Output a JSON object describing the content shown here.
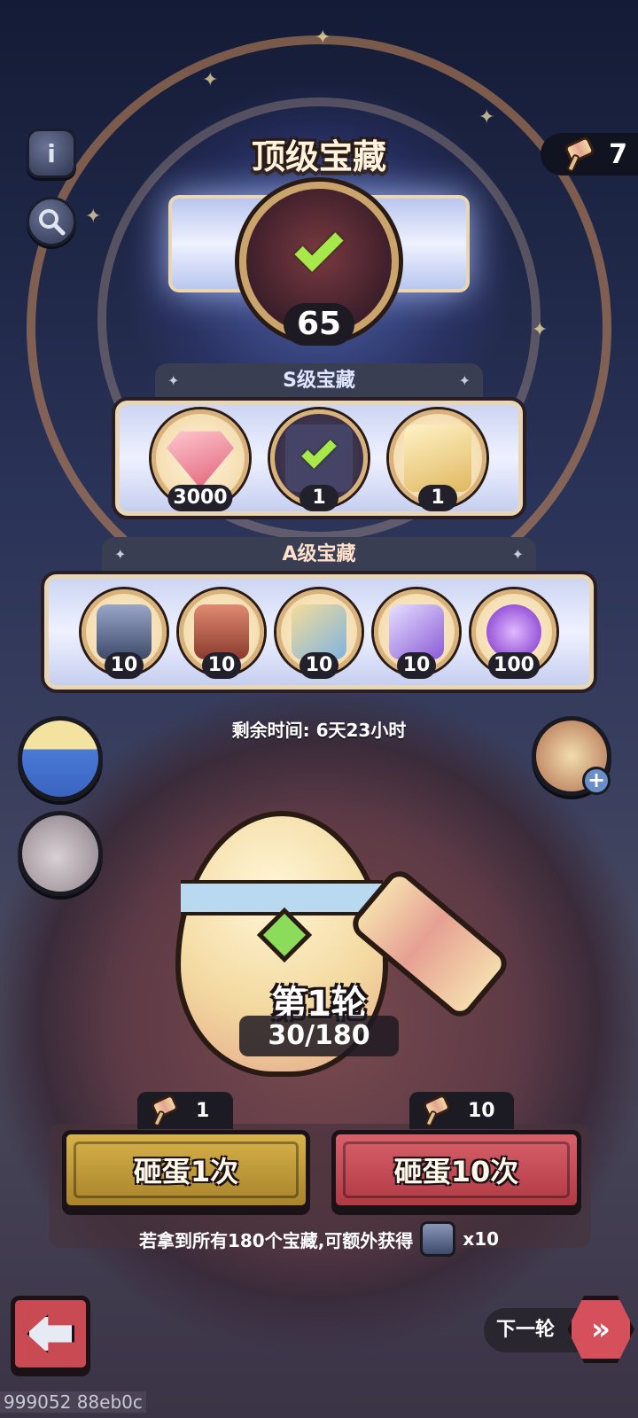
{
  "header": {
    "title": "顶级宝藏",
    "hammer_count": "7"
  },
  "grand_prize": {
    "count": "65",
    "claimed": true
  },
  "tier_s": {
    "label": "S级宝藏",
    "rewards": [
      {
        "icon": "pink-diamond-gem-icon",
        "count": "3000"
      },
      {
        "icon": "claimed-hero-badge-icon",
        "count": "1"
      },
      {
        "icon": "ssr-summon-ticket-icon",
        "count": "1"
      }
    ]
  },
  "tier_a": {
    "label": "A级宝藏",
    "rewards": [
      {
        "icon": "iron-helmet-chest-icon",
        "count": "10"
      },
      {
        "icon": "red-helmet-chest-icon",
        "count": "10"
      },
      {
        "icon": "golden-key-icon",
        "count": "10"
      },
      {
        "icon": "purple-scroll-icon",
        "count": "10"
      },
      {
        "icon": "purple-crystal-orb-icon",
        "count": "100"
      }
    ]
  },
  "timer": {
    "text": "剩余时间: 6天23小时"
  },
  "round": {
    "title": "第1轮",
    "progress_text": "30/180",
    "progress_value": 30,
    "progress_max": 180
  },
  "actions": {
    "smash_once": {
      "label": "砸蛋1次",
      "cost": "1"
    },
    "smash_ten": {
      "label": "砸蛋10次",
      "cost": "10"
    }
  },
  "bonus": {
    "text": "若拿到所有180个宝藏,可额外获得",
    "reward_count": "x10"
  },
  "footer": {
    "next_round_label": "下一轮",
    "debug_id": "999052 88eb0c"
  },
  "colors": {
    "accent_gold": "#d8b27a",
    "smash_once_button": "#c9a23a",
    "smash_ten_button": "#c94a52",
    "check_green": "#a7e84a"
  }
}
